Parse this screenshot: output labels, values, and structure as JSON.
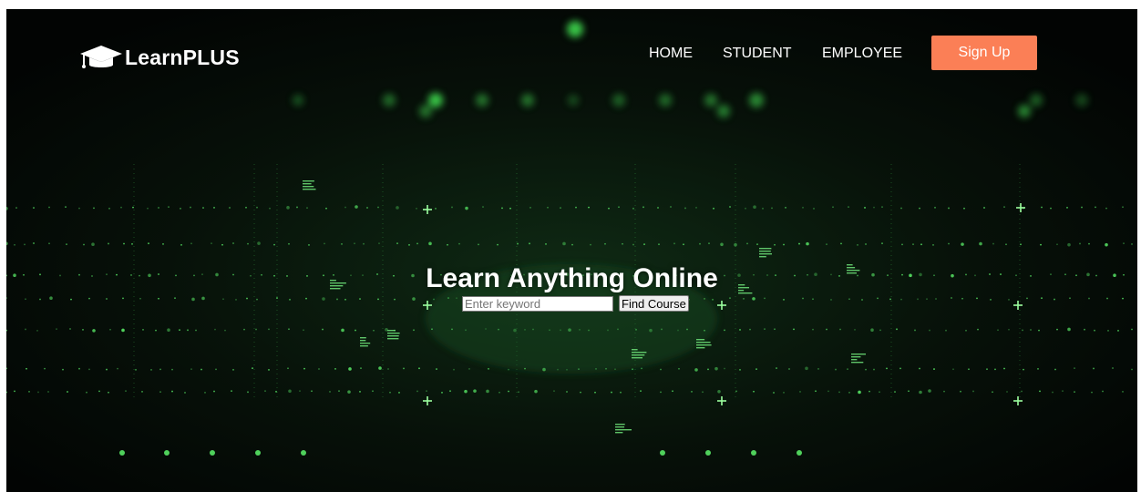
{
  "brand": {
    "name": "LearnPLUS",
    "logo_icon": "graduation-cap-icon"
  },
  "nav": {
    "items": [
      {
        "label": "HOME"
      },
      {
        "label": "STUDENT"
      },
      {
        "label": "EMPLOYEE"
      }
    ],
    "signup_label": "Sign Up"
  },
  "hero": {
    "title": "Learn Anything Online",
    "search_placeholder": "Enter keyword",
    "search_value": "",
    "search_button_label": "Find Course"
  },
  "colors": {
    "accent": "#fb7f56",
    "background": "#050805",
    "glow": "#5dff6a"
  }
}
